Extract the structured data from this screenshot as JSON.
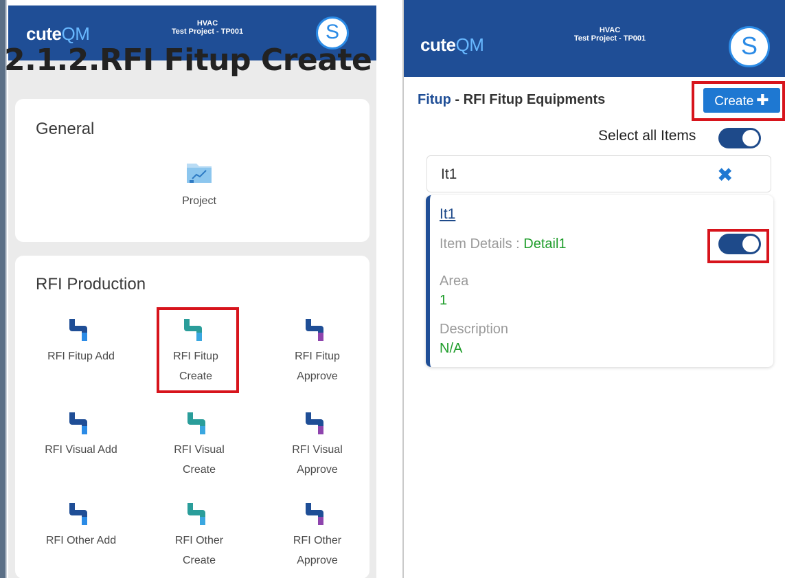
{
  "doc_title": "2.1.2.RFI Fitup Create",
  "app": {
    "brand_main": "cute",
    "brand_accent": "QM",
    "discipline": "HVAC",
    "project": "Test Project - TP001",
    "avatar_letter": "S"
  },
  "home": {
    "general": {
      "title": "General",
      "tiles": [
        {
          "label": "Project",
          "icon": "chart-folder-icon"
        }
      ]
    },
    "rfi_production": {
      "title": "RFI Production",
      "tiles": [
        {
          "label": "RFI Fitup Add",
          "icon": "pipe-elbow-icon"
        },
        {
          "label": "RFI Fitup Create",
          "icon": "pipe-elbow-icon"
        },
        {
          "label": "RFI Fitup Approve",
          "icon": "pipe-elbow-icon"
        },
        {
          "label": "RFI Visual Add",
          "icon": "pipe-elbow-icon"
        },
        {
          "label": "RFI Visual Create",
          "icon": "pipe-elbow-icon"
        },
        {
          "label": "RFI Visual Approve",
          "icon": "pipe-elbow-icon"
        },
        {
          "label": "RFI Other Add",
          "icon": "pipe-elbow-icon"
        },
        {
          "label": "RFI Other Create",
          "icon": "pipe-elbow-icon"
        },
        {
          "label": "RFI Other Approve",
          "icon": "pipe-elbow-icon"
        }
      ]
    }
  },
  "fitup_screen": {
    "heading_prefix": "Fitup",
    "heading_rest": " - RFI Fitup Equipments",
    "create_label": "Create",
    "select_all_label": "Select all Items",
    "search_value": "It1",
    "item": {
      "name": "It1",
      "details_label": "Item Details : ",
      "details_value": "Detail1",
      "area_label": "Area",
      "area_value": "1",
      "description_label": "Description",
      "description_value": "N/A"
    }
  },
  "colors": {
    "appbar": "#1f4e96",
    "accent": "#1e78d2",
    "highlight": "#d7141c",
    "green_value": "#1f9d2b"
  }
}
